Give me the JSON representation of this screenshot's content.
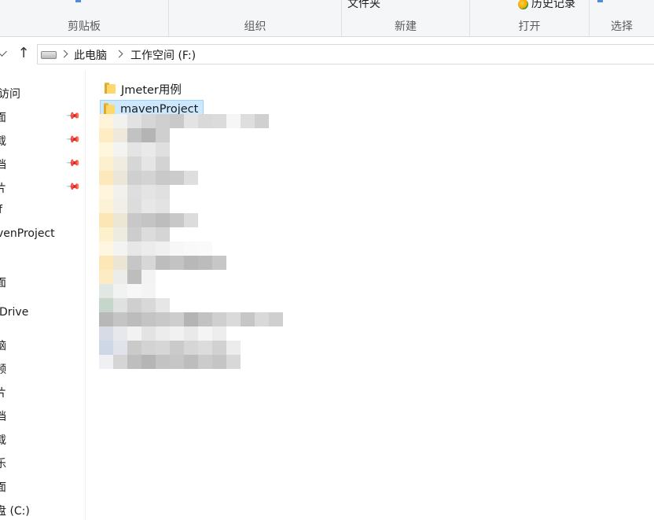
{
  "ribbon": {
    "groups": [
      "剪贴板",
      "组织",
      "新建",
      "打开",
      "选择"
    ],
    "top_buttons": {
      "new_folder": "文件夹",
      "history": "历史记录"
    },
    "history_icon": "history-icon"
  },
  "address": {
    "up_icon": "↑",
    "crumbs": [
      "此电脑",
      "工作空间 (F:)"
    ]
  },
  "navpane": {
    "items": [
      "访问",
      "面",
      "载",
      "档",
      "片",
      "f",
      "venProject",
      "面",
      "Drive",
      "脑",
      "频",
      "片",
      "档",
      "载",
      "乐",
      "面",
      "盘 (C:)"
    ],
    "pin_icon": "pin-icon"
  },
  "files": [
    {
      "name": "Jmeter用例",
      "selected": false,
      "icon": "folder-icon"
    },
    {
      "name": "mavenProject",
      "selected": true,
      "icon": "folder-icon"
    }
  ],
  "colors": {
    "selection_bg": "#cce8ff",
    "selection_border": "#99d1ff",
    "folder": "#ffd86b",
    "ribbon_bg": "#f5f6f7"
  }
}
